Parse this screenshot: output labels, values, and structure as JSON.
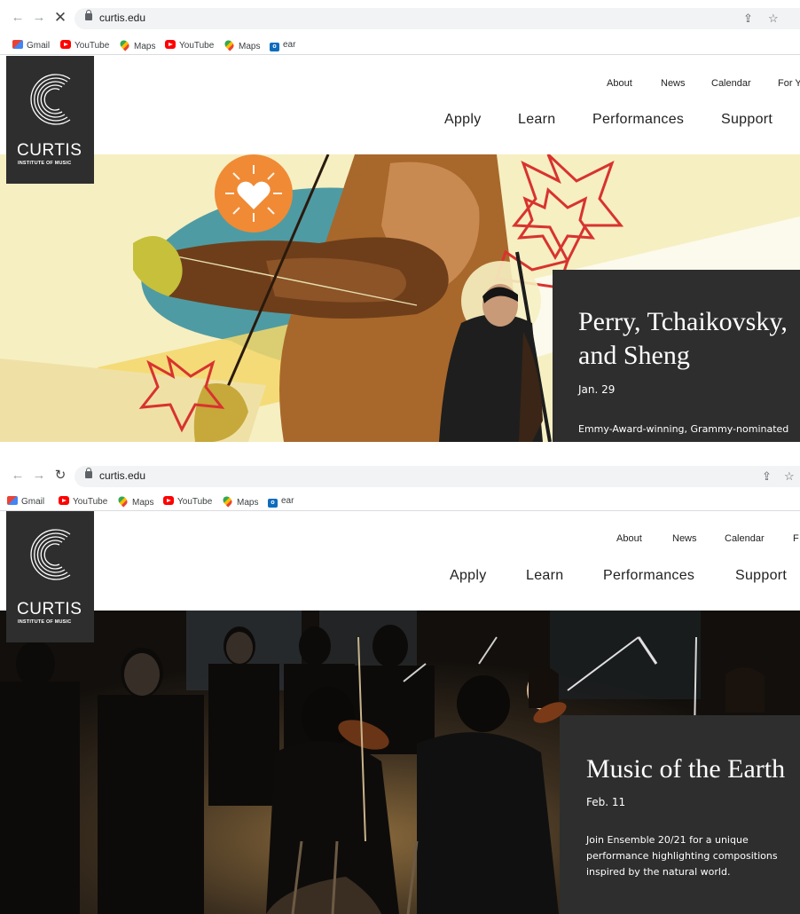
{
  "browser": {
    "url": "curtis.edu",
    "icons": {
      "back": "arrow-left-icon",
      "forward": "arrow-right-icon",
      "stop": "close-icon",
      "reload": "reload-icon",
      "share": "share-icon",
      "bookmark": "star-icon"
    },
    "bookmarks": [
      "Gmail",
      "YouTube",
      "Maps",
      "YouTube",
      "Maps",
      "ear"
    ]
  },
  "site": {
    "logo": {
      "name": "CURTIS",
      "subtitle": "INSTITUTE OF MUSIC"
    },
    "utility_nav": [
      "About",
      "News",
      "Calendar",
      "For Y"
    ],
    "utility_nav_2": [
      "About",
      "News",
      "Calendar",
      "F"
    ],
    "main_nav": [
      "Apply",
      "Learn",
      "Performances",
      "Support"
    ]
  },
  "hero_1": {
    "title_line1": "Perry, Tchaikovsky,",
    "title_line2": "and Sheng",
    "date": "Jan. 29",
    "description": "Emmy-Award-winning, Grammy-nominated"
  },
  "hero_2": {
    "title": "Music of the Earth",
    "date": "Feb. 11",
    "description_line1": "Join Ensemble 20/21 for a unique",
    "description_line2": "performance highlighting compositions",
    "description_line3": "inspired by the natural world."
  },
  "colors": {
    "card": "#2e2e2e",
    "hero_1_background": "#f6efc2",
    "accent_orange": "#f08a35",
    "accent_red": "#d8332f",
    "accent_teal": "#4f9ba3"
  }
}
